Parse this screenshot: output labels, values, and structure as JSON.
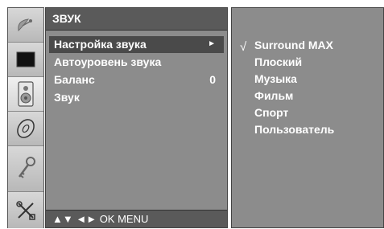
{
  "menu": {
    "title": "ЗВУК",
    "items": [
      {
        "label": "Настройка звука",
        "value": "►"
      },
      {
        "label": "Автоуровень звука",
        "value": ""
      },
      {
        "label": "Баланс",
        "value": "0"
      },
      {
        "label": "Звук",
        "value": ""
      }
    ],
    "selected_index": 0,
    "nav_hint": "▲▼ ◄► OK MENU"
  },
  "submenu": {
    "check_mark": "√",
    "options": [
      "Surround MAX",
      "Плоский",
      "Музыка",
      "Фильм",
      "Спорт",
      "Пользователь"
    ],
    "selected_index": 0
  },
  "icons": [
    {
      "name": "satellite-dish-icon"
    },
    {
      "name": "picture-icon"
    },
    {
      "name": "speaker-icon"
    },
    {
      "name": "disc-icon"
    },
    {
      "name": "key-icon"
    },
    {
      "name": "tools-icon"
    }
  ],
  "colors": {
    "panel": "#8c8c8c",
    "title_bar": "#5a5a5a",
    "selected_row": "#4a4a4a",
    "text": "#ffffff"
  }
}
